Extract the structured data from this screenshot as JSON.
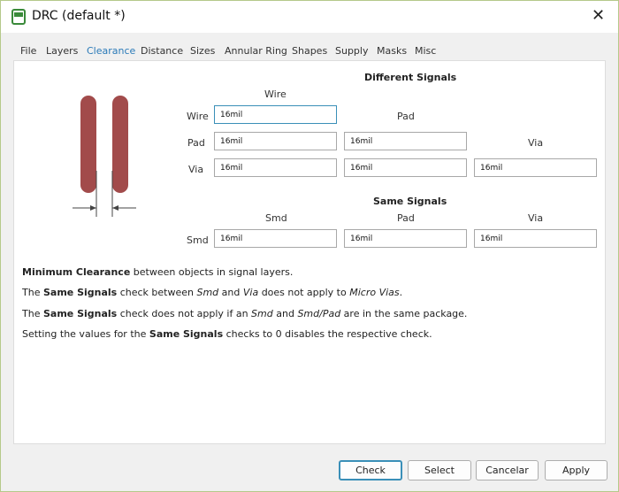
{
  "window": {
    "title": "DRC (default *)",
    "close": "✕"
  },
  "tabs": [
    "File",
    "Layers",
    "Clearance",
    "Distance",
    "Sizes",
    "Annular Ring",
    "Shapes",
    "Supply",
    "Masks",
    "Misc"
  ],
  "active_tab": "Clearance",
  "different_signals": {
    "heading": "Different Signals",
    "col_headers": [
      "Wire",
      "Pad",
      "Via"
    ],
    "row_labels": [
      "Wire",
      "Pad",
      "Via"
    ],
    "values": {
      "wire_wire": "16mil",
      "pad_wire": "16mil",
      "pad_pad": "16mil",
      "via_wire": "16mil",
      "via_pad": "16mil",
      "via_via": "16mil"
    }
  },
  "same_signals": {
    "heading": "Same Signals",
    "col_headers": [
      "Smd",
      "Pad",
      "Via"
    ],
    "row_label": "Smd",
    "values": [
      "16mil",
      "16mil",
      "16mil"
    ]
  },
  "notes": [
    {
      "parts": [
        {
          "t": "Minimum Clearance",
          "s": "b"
        },
        {
          "t": " between objects in signal layers.",
          "s": ""
        }
      ]
    },
    {
      "parts": [
        {
          "t": "The ",
          "s": ""
        },
        {
          "t": "Same Signals",
          "s": "b"
        },
        {
          "t": " check between ",
          "s": ""
        },
        {
          "t": "Smd",
          "s": "i"
        },
        {
          "t": " and ",
          "s": ""
        },
        {
          "t": "Via",
          "s": "i"
        },
        {
          "t": " does not apply to ",
          "s": ""
        },
        {
          "t": "Micro Vias",
          "s": "i"
        },
        {
          "t": ".",
          "s": ""
        }
      ]
    },
    {
      "parts": [
        {
          "t": "The ",
          "s": ""
        },
        {
          "t": "Same Signals",
          "s": "b"
        },
        {
          "t": " check does not apply if an ",
          "s": ""
        },
        {
          "t": "Smd",
          "s": "i"
        },
        {
          "t": " and ",
          "s": ""
        },
        {
          "t": "Smd/Pad",
          "s": "i"
        },
        {
          "t": " are in the same package.",
          "s": ""
        }
      ]
    },
    {
      "parts": [
        {
          "t": "Setting the values for the ",
          "s": ""
        },
        {
          "t": "Same Signals",
          "s": "b"
        },
        {
          "t": " checks to 0 disables the respective check.",
          "s": ""
        }
      ]
    }
  ],
  "buttons": {
    "check": "Check",
    "select": "Select",
    "cancel": "Cancelar",
    "apply": "Apply"
  },
  "colors": {
    "accent": "#2a7ab8",
    "trace": "#a24b4b"
  }
}
